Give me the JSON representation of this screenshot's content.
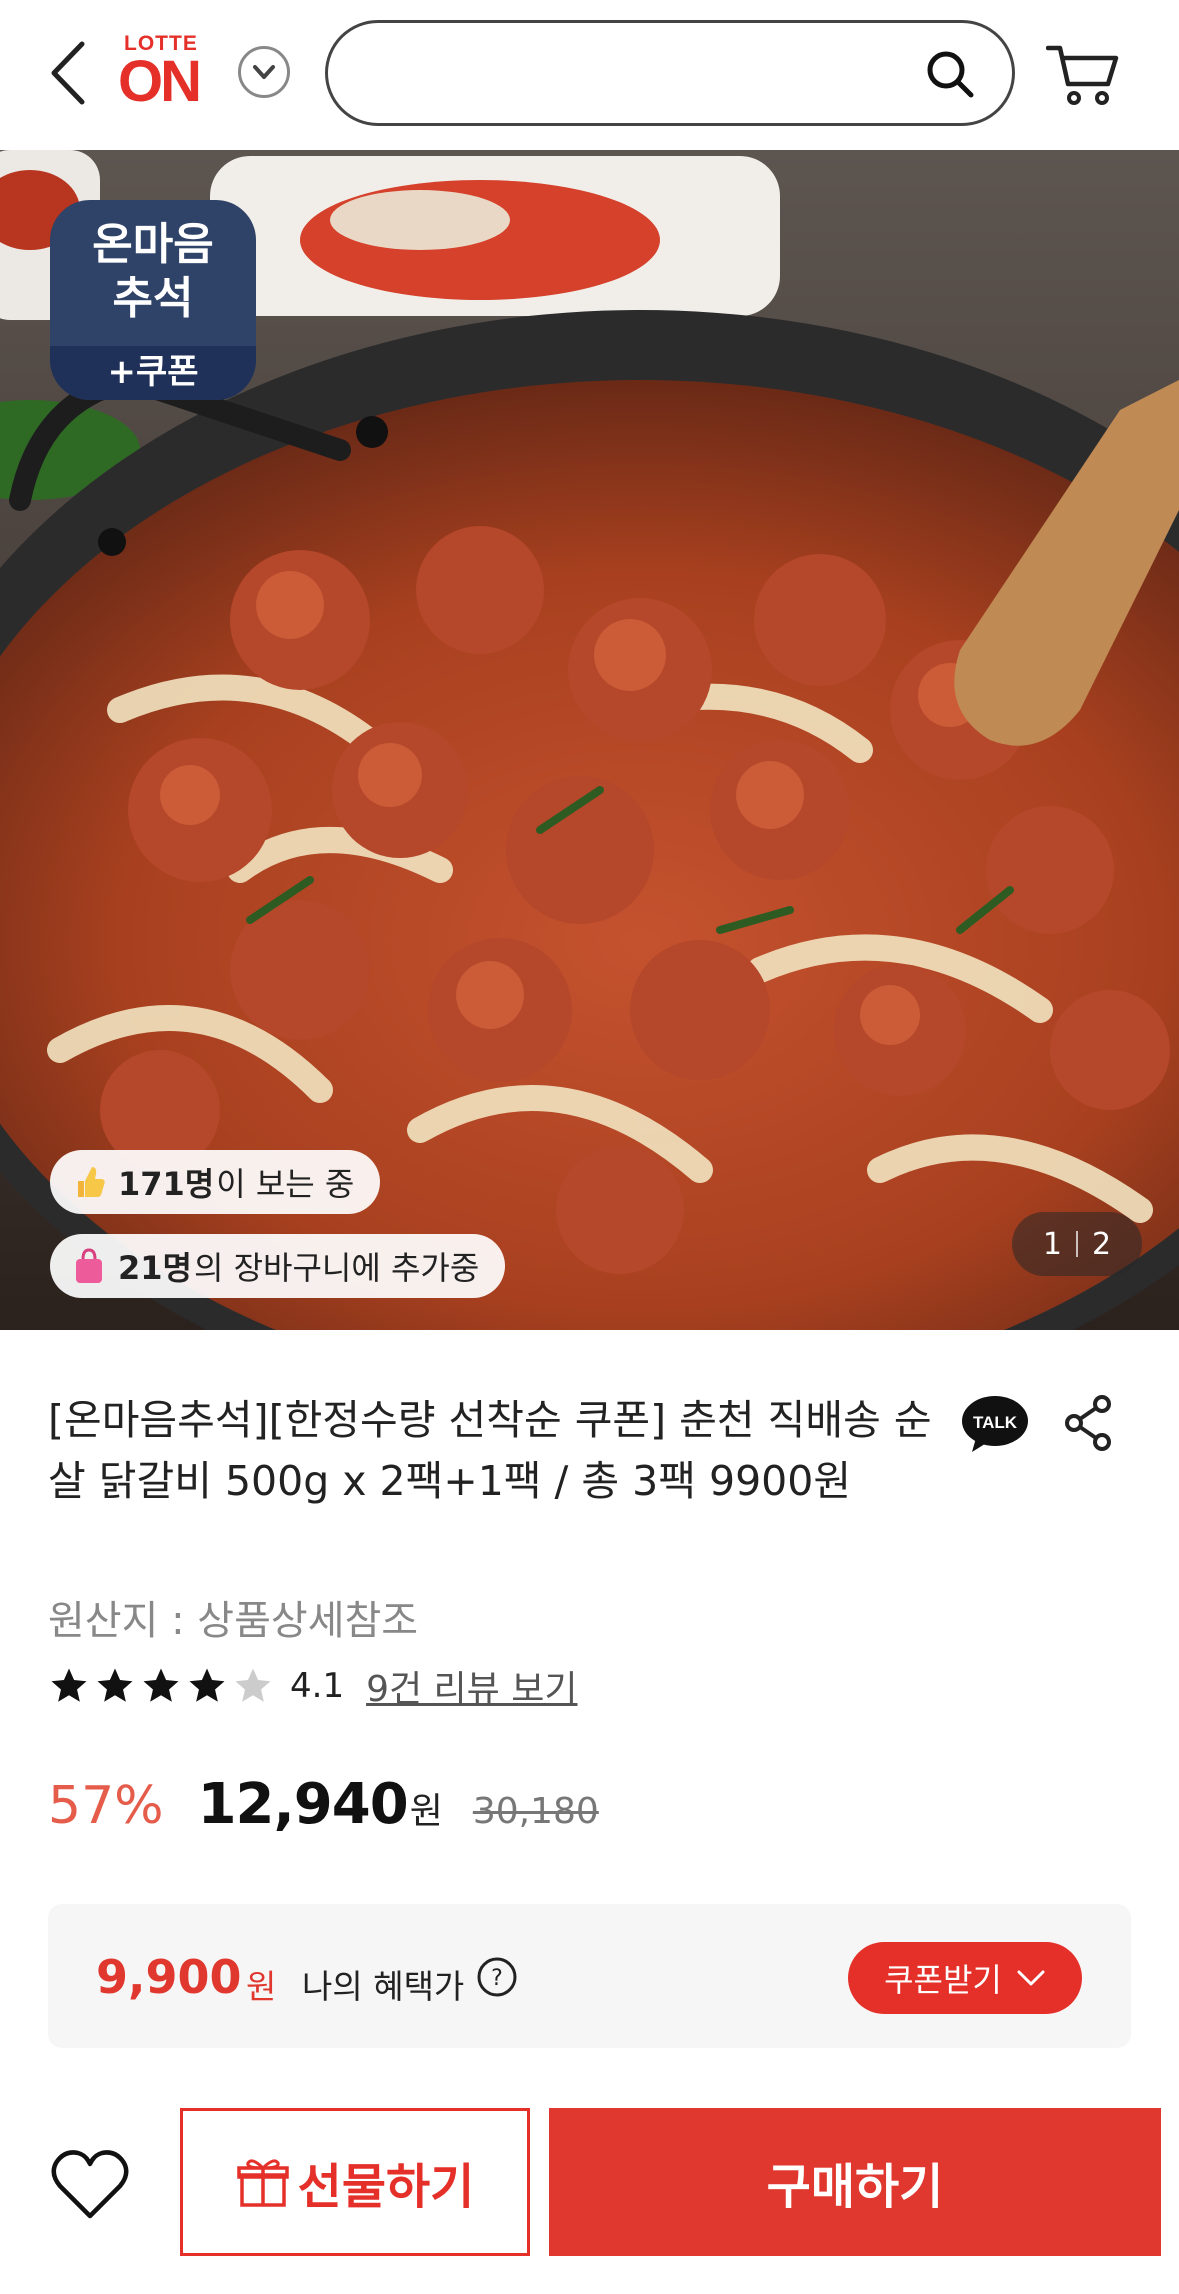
{
  "header": {
    "logo_top": "LOTTE",
    "logo_main": "ON",
    "search_placeholder": "",
    "icons": {
      "back": "chevron-left-icon",
      "logo_menu": "chevron-down-icon",
      "search": "search-icon",
      "cart": "cart-icon"
    }
  },
  "hero": {
    "badge": {
      "line1": "온마음",
      "line2": "추석",
      "bottom": "+쿠폰"
    },
    "viewers": {
      "count": "171명",
      "text": "이 보는 중"
    },
    "cart_adds": {
      "count": "21명",
      "text": "의 장바구니에 추가중"
    },
    "pager": {
      "current": "1",
      "total": "2"
    }
  },
  "product": {
    "title": "[온마음추석][한정수량 선착순 쿠폰] 춘천 직배송 순살 닭갈비 500g x 2팩+1팩 / 총 3팩 9900원",
    "origin": "원산지 : 상품상세참조",
    "rating": {
      "stars": 4,
      "max": 5,
      "score": "4.1",
      "reviews_link": "9건 리뷰 보기"
    },
    "price": {
      "discount": "57%",
      "sale": "12,940",
      "unit": "원",
      "original": "30,180"
    },
    "benefit": {
      "price": "9,900",
      "unit": "원",
      "label": "나의 혜택가",
      "coupon_button": "쿠폰받기"
    }
  },
  "bottom_bar": {
    "gift_label": "선물하기",
    "buy_label": "구매하기"
  },
  "colors": {
    "brand_red": "#e5302a",
    "badge_navy": "#2f4268"
  }
}
